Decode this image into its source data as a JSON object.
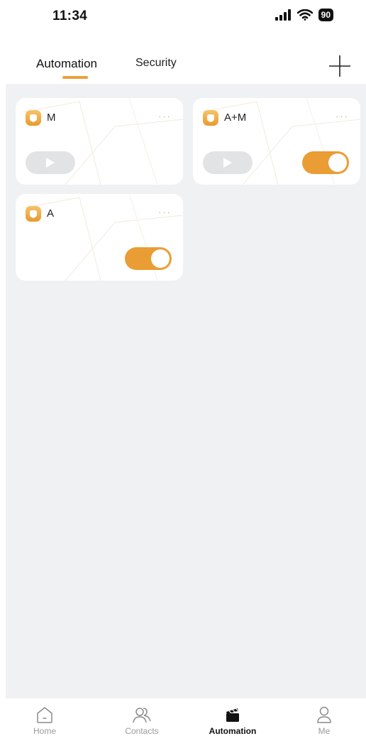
{
  "status_bar": {
    "time": "11:34",
    "battery": "90"
  },
  "header": {
    "tabs": [
      {
        "label": "Automation",
        "active": true
      },
      {
        "label": "Security",
        "active": false
      }
    ],
    "add_icon": "plus-icon"
  },
  "colors": {
    "accent": "#EAA13B",
    "toggle_on": "#EA9D34",
    "page_bg": "#F0F1F3",
    "play_bg": "#E2E3E5"
  },
  "cards": [
    {
      "name": "M",
      "more": "···",
      "control": "play-button"
    },
    {
      "name": "A+M",
      "more": "···",
      "control": "play-button",
      "toggle_on": true
    },
    {
      "name": "A",
      "more": "···",
      "control": "toggle",
      "toggle_on": true
    }
  ],
  "bottom_nav": {
    "items": [
      {
        "label": "Home",
        "icon": "home-icon",
        "active": false
      },
      {
        "label": "Contacts",
        "icon": "contacts-icon",
        "active": false
      },
      {
        "label": "Automation",
        "icon": "clapperboard-icon",
        "active": true
      },
      {
        "label": "Me",
        "icon": "person-icon",
        "active": false
      }
    ]
  }
}
